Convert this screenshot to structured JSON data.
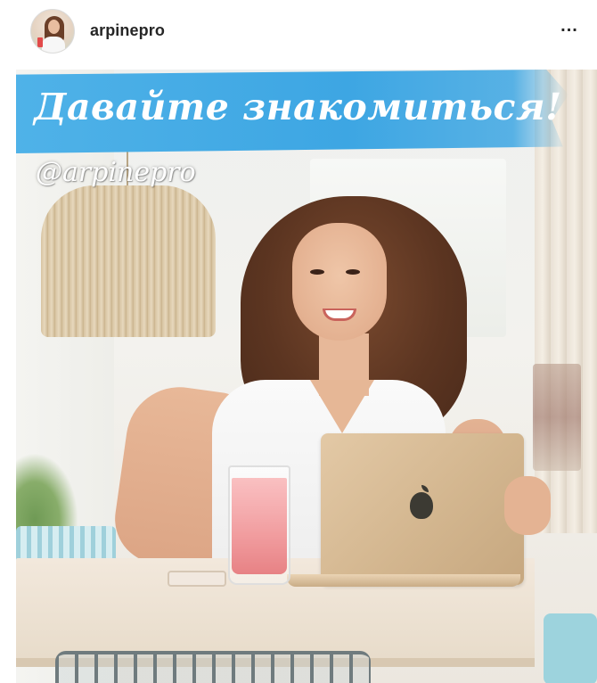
{
  "post": {
    "username": "arpinepro",
    "more_label": "...",
    "image": {
      "banner_text": "Давайте знакомиться!",
      "handle_text": "@arpinepro"
    }
  },
  "icons": {
    "avatar": "user-avatar",
    "more": "more-options-icon",
    "apple": "apple-logo"
  },
  "colors": {
    "banner": "#3da6e3",
    "username": "#262626",
    "drink": "#e54b4f"
  }
}
